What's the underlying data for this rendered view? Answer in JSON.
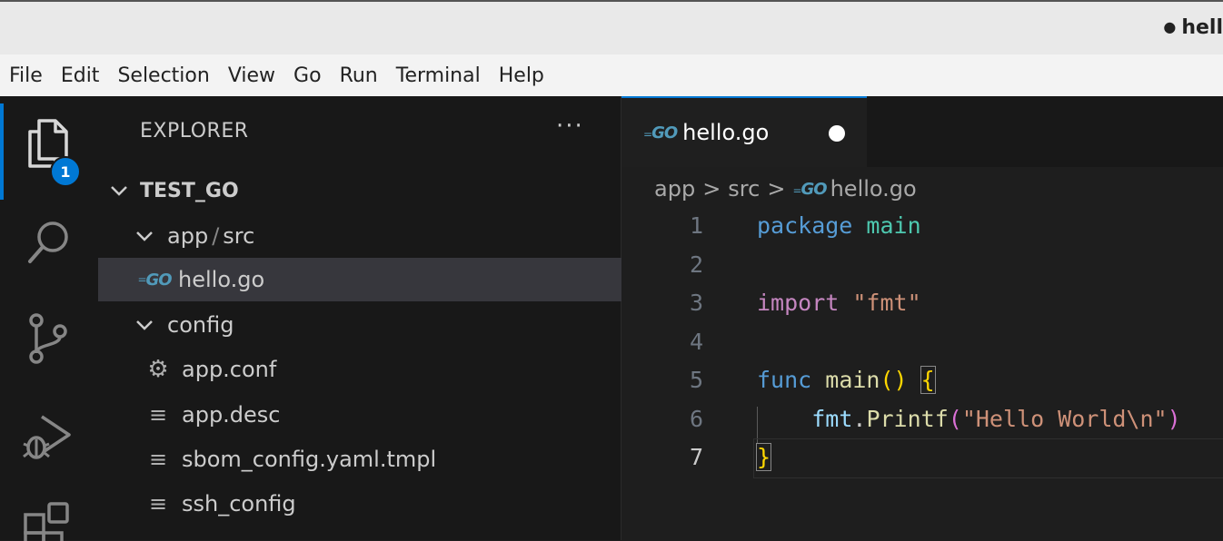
{
  "window": {
    "title": "hell",
    "dirty_marker": "●"
  },
  "menu": [
    "File",
    "Edit",
    "Selection",
    "View",
    "Go",
    "Run",
    "Terminal",
    "Help"
  ],
  "activity_bar": {
    "items": [
      {
        "name": "explorer-icon",
        "active": true
      },
      {
        "name": "search-icon",
        "active": false
      },
      {
        "name": "source-control-icon",
        "active": false
      },
      {
        "name": "run-debug-icon",
        "active": false
      },
      {
        "name": "extensions-icon",
        "active": false
      }
    ],
    "explorer_badge": "1"
  },
  "sidebar": {
    "title": "EXPLORER",
    "more_label": "···",
    "root": "TEST_GO",
    "tree": [
      {
        "label_a": "app",
        "label_sep": "/",
        "label_b": "src",
        "kind": "folder"
      },
      {
        "label": "hello.go",
        "kind": "go",
        "selected": true
      },
      {
        "label": "config",
        "kind": "folder"
      },
      {
        "label": "app.conf",
        "kind": "gear"
      },
      {
        "label": "app.desc",
        "kind": "text"
      },
      {
        "label": "sbom_config.yaml.tmpl",
        "kind": "text"
      },
      {
        "label": "ssh_config",
        "kind": "text"
      }
    ]
  },
  "editor": {
    "tab": {
      "label": "hello.go",
      "icon": "GO"
    },
    "breadcrumb": {
      "part1": "app",
      "sep": ">",
      "part2": "src",
      "file": "hello.go",
      "icon": "GO"
    },
    "lines": [
      {
        "n": "1",
        "tokens": [
          {
            "t": "package",
            "c": "kw-pkg"
          },
          {
            "t": " "
          },
          {
            "t": "main",
            "c": "ident-green"
          }
        ]
      },
      {
        "n": "2",
        "tokens": []
      },
      {
        "n": "3",
        "tokens": [
          {
            "t": "import",
            "c": "kw-import"
          },
          {
            "t": " "
          },
          {
            "t": "\"fmt\"",
            "c": "str"
          }
        ]
      },
      {
        "n": "4",
        "tokens": []
      },
      {
        "n": "5",
        "tokens": [
          {
            "t": "func",
            "c": "kw-func"
          },
          {
            "t": " "
          },
          {
            "t": "main",
            "c": "fn"
          },
          {
            "t": "()",
            "c": "brace"
          },
          {
            "t": " "
          },
          {
            "t": "{",
            "c": "brace brace-hl"
          }
        ]
      },
      {
        "n": "6",
        "tokens": [
          {
            "t": "    "
          },
          {
            "t": "fmt",
            "c": "var"
          },
          {
            "t": "."
          },
          {
            "t": "Printf",
            "c": "fn"
          },
          {
            "t": "(",
            "c": "paren2"
          },
          {
            "t": "\"Hello World\\n\"",
            "c": "str"
          },
          {
            "t": ")",
            "c": "paren2"
          }
        ]
      },
      {
        "n": "7",
        "tokens": [
          {
            "t": "}",
            "c": "brace brace-hl"
          }
        ],
        "current": true
      }
    ]
  }
}
